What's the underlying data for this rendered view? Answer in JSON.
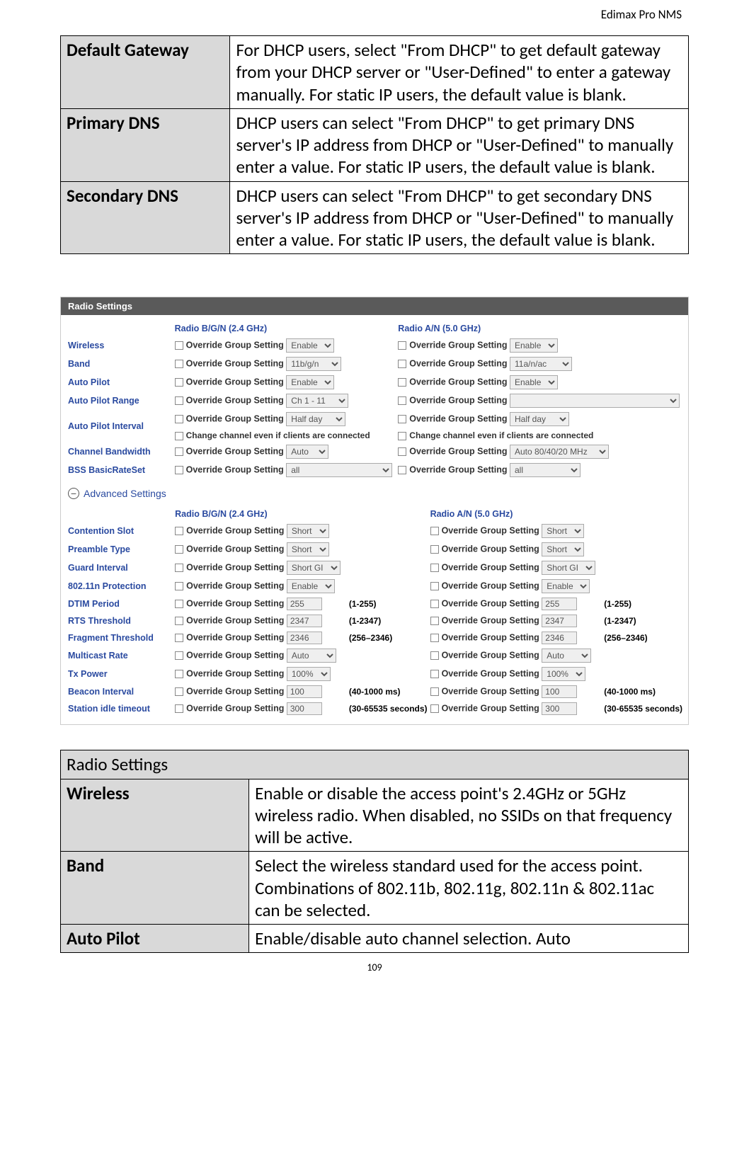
{
  "header": {
    "doc_title": "Edimax Pro NMS",
    "page_number": "109"
  },
  "topTable": {
    "r1_label": "Default Gateway",
    "r1_text": "For DHCP users, select \"From DHCP\" to get default gateway from your DHCP server or \"User-Defined\" to enter a gateway manually. For static IP users, the default value is blank.",
    "r2_label": "Primary DNS",
    "r2_text": "DHCP users can select \"From DHCP\" to get primary DNS server's IP address from DHCP or \"User-Defined\" to manually enter a value. For static IP users, the default value is blank.",
    "r3_label": "Secondary DNS",
    "r3_text": "DHCP users can select \"From DHCP\" to get secondary DNS server's IP address from DHCP or \"User-Defined\" to manually enter a value. For static IP users, the default value is blank."
  },
  "panel": {
    "title": "Radio Settings",
    "col24": "Radio B/G/N (2.4 GHz)",
    "col50": "Radio A/N (5.0 GHz)",
    "override": "Override Group Setting",
    "advanced": "Advanced Settings",
    "change_note": "Change channel even if clients are connected",
    "rows": {
      "wireless": {
        "label": "Wireless",
        "v24": "Enable",
        "v50": "Enable"
      },
      "band": {
        "label": "Band",
        "v24": "11b/g/n",
        "v50": "11a/n/ac"
      },
      "autopilot": {
        "label": "Auto Pilot",
        "v24": "Enable",
        "v50": "Enable"
      },
      "aprange": {
        "label": "Auto Pilot Range",
        "v24": "Ch 1 - 11",
        "v50": ""
      },
      "apinterval": {
        "label": "Auto Pilot Interval",
        "v24": "Half day",
        "v50": "Half day"
      },
      "chbw": {
        "label": "Channel Bandwidth",
        "v24": "Auto",
        "v50": "Auto 80/40/20 MHz"
      },
      "bssrate": {
        "label": "BSS BasicRateSet",
        "v24": "all",
        "v50": "all"
      },
      "cslot": {
        "label": "Contention Slot",
        "v24": "Short",
        "v50": "Short"
      },
      "preamble": {
        "label": "Preamble Type",
        "v24": "Short",
        "v50": "Short"
      },
      "gi": {
        "label": "Guard Interval",
        "v24": "Short GI",
        "v50": "Short GI"
      },
      "dot11n": {
        "label": "802.11n Protection",
        "v24": "Enable",
        "v50": "Enable"
      },
      "dtim": {
        "label": "DTIM Period",
        "v24": "255",
        "v50": "255",
        "hint": "(1-255)"
      },
      "rts": {
        "label": "RTS Threshold",
        "v24": "2347",
        "v50": "2347",
        "hint": "(1-2347)"
      },
      "frag": {
        "label": "Fragment Threshold",
        "v24": "2346",
        "v50": "2346",
        "hint": "(256–2346)"
      },
      "mcast": {
        "label": "Multicast Rate",
        "v24": "Auto",
        "v50": "Auto"
      },
      "txpower": {
        "label": "Tx Power",
        "v24": "100%",
        "v50": "100%"
      },
      "beacon": {
        "label": "Beacon Interval",
        "v24": "100",
        "v50": "100",
        "hint": "(40-1000 ms)"
      },
      "idle": {
        "label": "Station idle timeout",
        "v24": "300",
        "v50": "300",
        "hint": "(30-65535 seconds)"
      }
    }
  },
  "bottomTable": {
    "heading": "Radio Settings",
    "r1_label": "Wireless",
    "r1_text": "Enable or disable the access point's 2.4GHz or 5GHz wireless radio. When disabled, no SSIDs on that frequency will be active.",
    "r2_label": "Band",
    "r2_text": "Select the wireless standard used for the access point. Combinations of 802.11b, 802.11g, 802.11n & 802.11ac can be selected.",
    "r3_label": "Auto Pilot",
    "r3_text": "Enable/disable auto channel selection. Auto"
  }
}
